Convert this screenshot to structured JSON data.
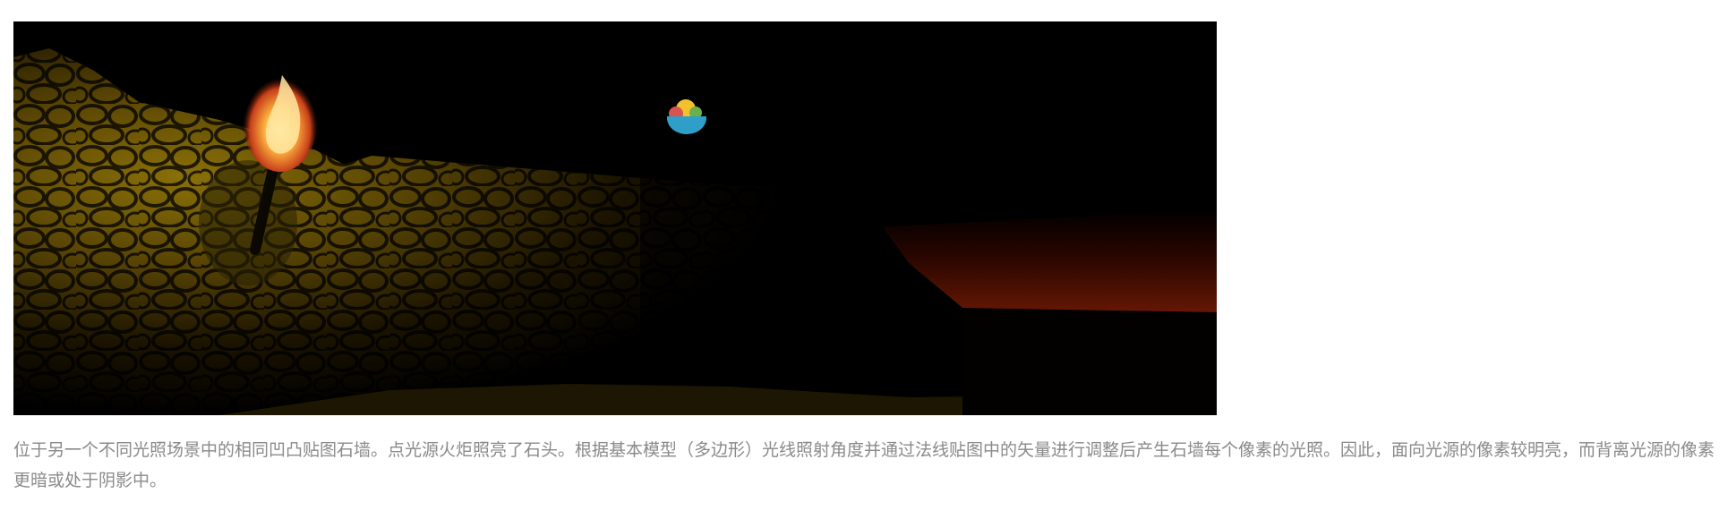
{
  "figure": {
    "caption": "位于另一个不同光照场景中的相同凹凸贴图石墙。点光源火炬照亮了石头。根据基本模型（多边形）光线照射角度并通过法线贴图中的矢量进行调整后产生石墙每个像素的光照。因此，面向光源的像素较明亮，而背离光源的像素更暗或处于阴影中。",
    "scene_elements": [
      "stone-wall",
      "torch",
      "flame",
      "bowl-icon",
      "red-glow-horizon",
      "floor"
    ]
  },
  "colors": {
    "caption_text": "#8a8a8a",
    "wall_highlight": "#7a6408",
    "wall_shadow": "#1e1600",
    "glow": "#5a1204",
    "bowl": "#2f9fc9"
  }
}
